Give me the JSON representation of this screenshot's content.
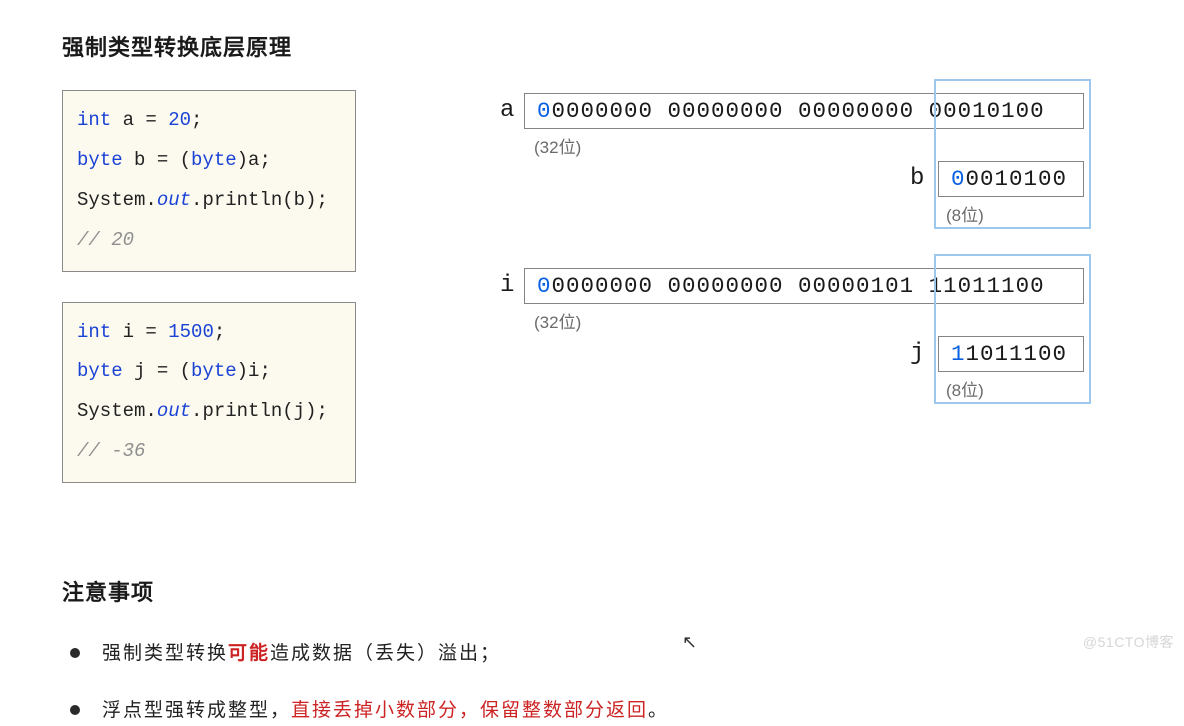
{
  "heading1": "强制类型转换底层原理",
  "code1": {
    "l1_type": "int",
    "l1_var": " a = ",
    "l1_num": "20",
    "l1_end": ";",
    "l2_type": "byte",
    "l2_var": " b =  (",
    "l2_cast": "byte",
    "l2_castend": ")a;",
    "l3_pre": "System.",
    "l3_out": "out",
    "l3_call": ".println(b); ",
    "l3_cm": "// 20"
  },
  "code2": {
    "l1_type": "int",
    "l1_var": " i = ",
    "l1_num": "1500",
    "l1_end": ";",
    "l2_type": "byte",
    "l2_var": " j =  (",
    "l2_cast": "byte",
    "l2_castend": ")i;",
    "l3_pre": "System.",
    "l3_out": "out",
    "l3_call": ".println(j); ",
    "l3_cm": "// -36"
  },
  "diag1": {
    "var_a": "a",
    "bin_a_lead": "0",
    "bin_a_rest": "0000000 00000000 00000000 00010100",
    "size32": "(32位)",
    "var_b": "b",
    "bin_b_lead": "0",
    "bin_b_rest": "0010100",
    "size8": "(8位)"
  },
  "diag2": {
    "var_i": "i",
    "bin_i_lead": "0",
    "bin_i_rest": "0000000 00000000 00000101 11011100",
    "size32": "(32位)",
    "var_j": "j",
    "bin_j_lead": "1",
    "bin_j_rest": "1011100",
    "size8": "(8位)"
  },
  "heading2": "注意事项",
  "note1_p1": "强制类型转换",
  "note1_red": "可能",
  "note1_p2": "造成数据（丢失）溢出；",
  "note2_p1": "浮点型强转成整型，",
  "note2_red": "直接丢掉小数部分，保留整数部分返回",
  "note2_p2": "。",
  "watermark": "@51CTO博客"
}
